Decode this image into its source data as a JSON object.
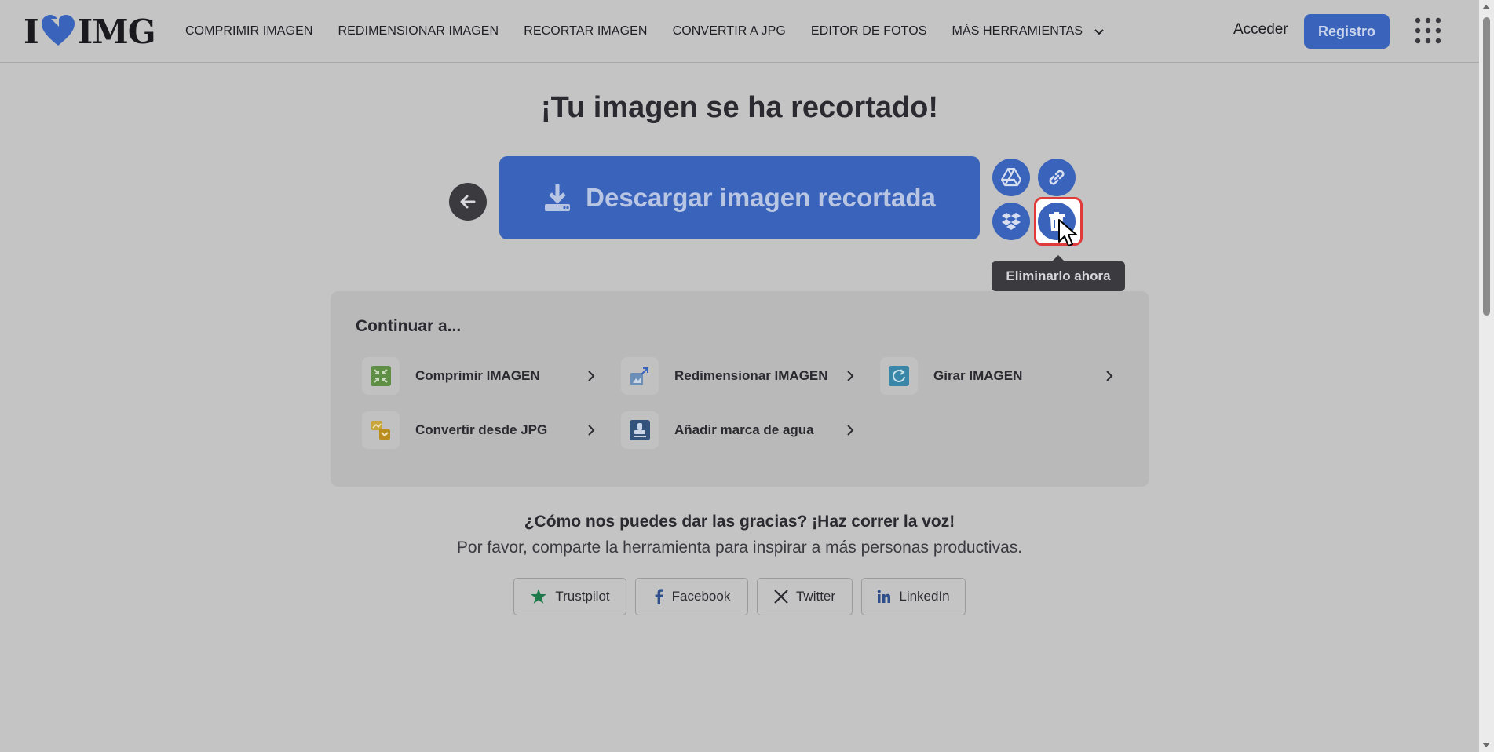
{
  "header": {
    "logo_left": "I",
    "logo_right": "IMG",
    "nav": [
      "COMPRIMIR IMAGEN",
      "REDIMENSIONAR IMAGEN",
      "RECORTAR IMAGEN",
      "CONVERTIR A JPG",
      "EDITOR DE FOTOS",
      "MÁS HERRAMIENTAS"
    ],
    "login": "Acceder",
    "signup": "Registro"
  },
  "main": {
    "title": "¡Tu imagen se ha recortado!",
    "download_label": "Descargar imagen recortada",
    "tooltip": "Eliminarlo ahora"
  },
  "continue": {
    "title": "Continuar a...",
    "tools": [
      {
        "label": "Comprimir IMAGEN",
        "icon": "compress-icon"
      },
      {
        "label": "Redimensionar IMAGEN",
        "icon": "resize-icon"
      },
      {
        "label": "Girar IMAGEN",
        "icon": "rotate-icon"
      },
      {
        "label": "Convertir desde JPG",
        "icon": "convert-icon"
      },
      {
        "label": "Añadir marca de agua",
        "icon": "watermark-icon"
      }
    ]
  },
  "share": {
    "title": "¿Cómo nos puedes dar las gracias? ¡Haz correr la voz!",
    "subtitle": "Por favor, comparte la herramienta para inspirar a más personas productivas.",
    "buttons": [
      "Trustpilot",
      "Facebook",
      "Twitter",
      "LinkedIn"
    ]
  },
  "colors": {
    "brand_blue": "#3a64bb",
    "overlay_bg": "#c4c4c4",
    "highlight_red": "#e03b3b"
  }
}
